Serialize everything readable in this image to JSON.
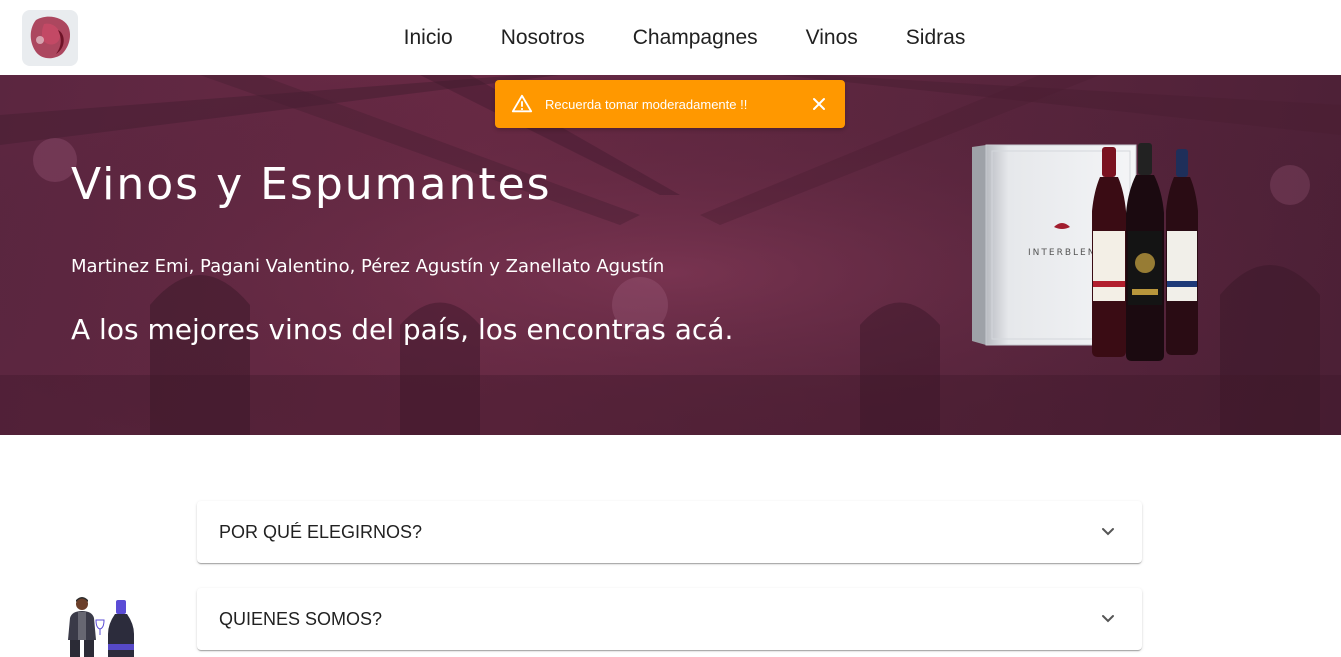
{
  "nav": {
    "links": [
      "Inicio",
      "Nosotros",
      "Champagnes",
      "Vinos",
      "Sidras"
    ]
  },
  "hero": {
    "title": "Vinos y Espumantes",
    "authors": "Martinez Emi, Pagani Valentino, Pérez Agustín y Zanellato Agustín",
    "tagline": "A los mejores vinos del país, los encontras acá.",
    "brand_text": "INTERBLEND"
  },
  "alert": {
    "text": "Recuerda tomar moderadamente !!",
    "color": "#ff9800"
  },
  "accordion": {
    "items": [
      "POR QUÉ ELEGIRNOS?",
      "QUIENES SOMOS?"
    ]
  },
  "colors": {
    "hero_bg": "#5b2640",
    "accent_purple": "#5b4cd6",
    "wine": "#8e1d2c"
  },
  "icons": {
    "alert": "warning-icon",
    "close": "close-icon",
    "expand": "chevron-down-icon"
  }
}
